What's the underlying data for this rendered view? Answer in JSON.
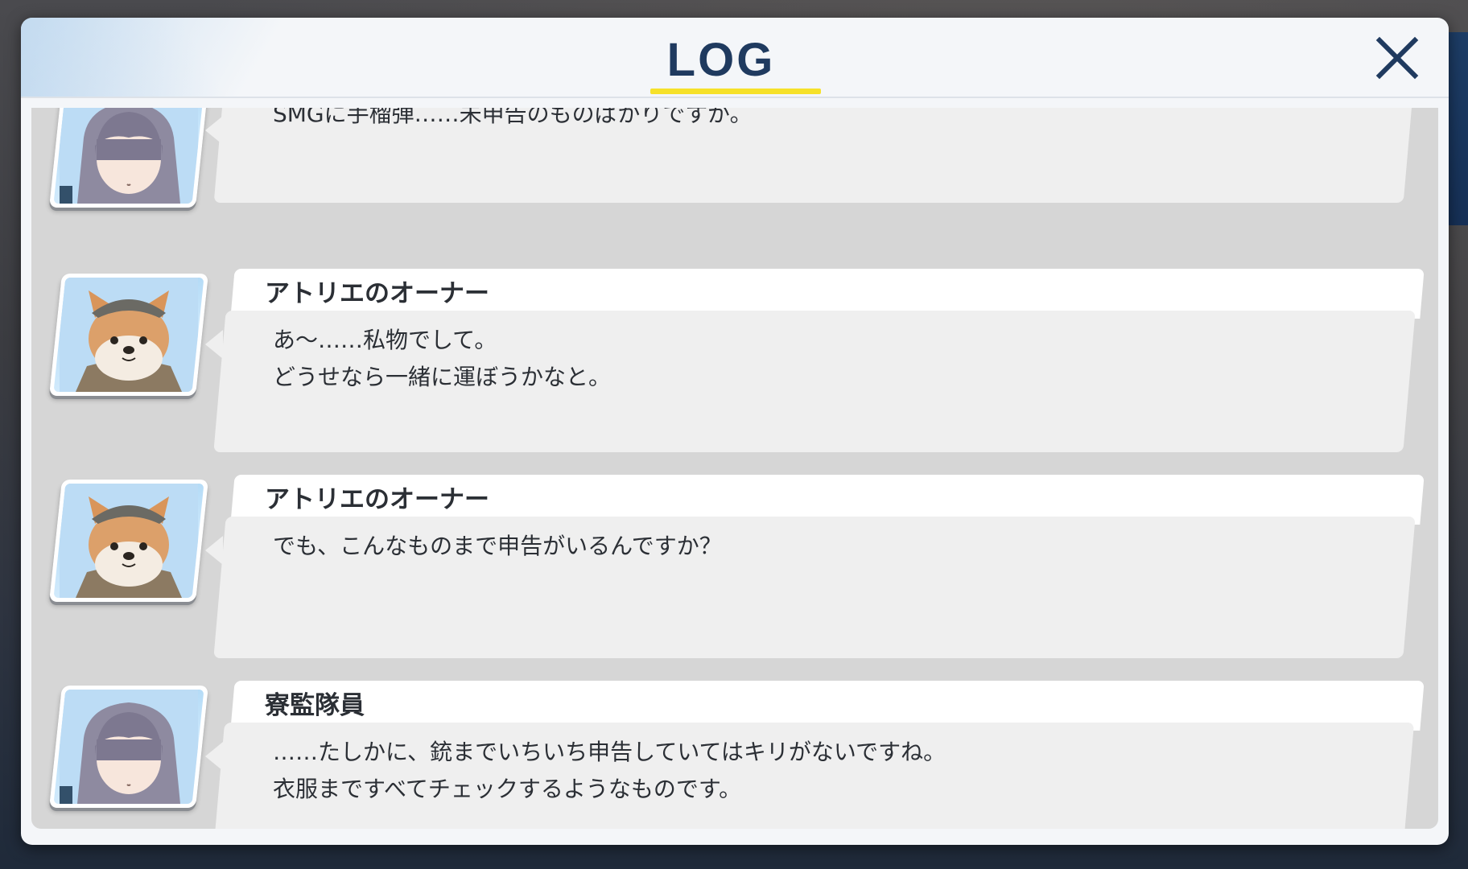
{
  "header": {
    "title": "LOG",
    "close_icon": "close-icon"
  },
  "colors": {
    "title": "#1f3a5f",
    "accent_underline": "#f6e12a",
    "bubble": "#efefef",
    "name_tab": "#ffffff",
    "log_background": "#d6d6d6"
  },
  "log": [
    {
      "speaker": "",
      "portrait": "student-portrait-icon",
      "lines": "SMGに手榴弾……未申告のものばかりですが。"
    },
    {
      "speaker": "アトリエのオーナー",
      "portrait": "dog-portrait-icon",
      "lines": "あ〜……私物でして。\nどうせなら一緒に運ぼうかなと。"
    },
    {
      "speaker": "アトリエのオーナー",
      "portrait": "dog-portrait-icon",
      "lines": "でも、こんなものまで申告がいるんですか？"
    },
    {
      "speaker": "寮監隊員",
      "portrait": "student-portrait-icon",
      "lines": "……たしかに、銃までいちいち申告していてはキリがないですね。\n衣服まですべてチェックするようなものです。"
    }
  ]
}
